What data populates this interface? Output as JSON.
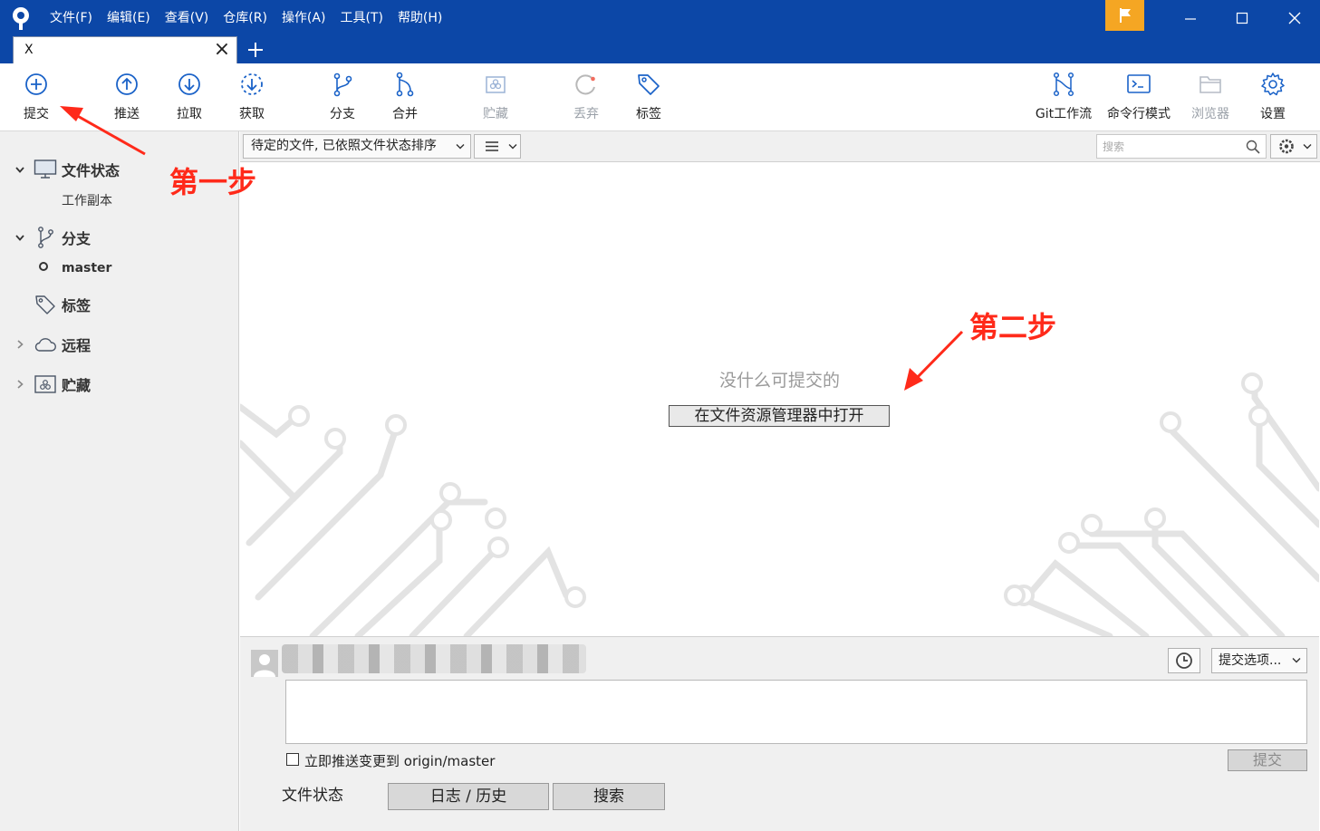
{
  "app": {
    "menu": [
      "文件(F)",
      "编辑(E)",
      "查看(V)",
      "仓库(R)",
      "操作(A)",
      "工具(T)",
      "帮助(H)"
    ],
    "tab_title": "X"
  },
  "toolbar": {
    "commit": "提交",
    "push": "推送",
    "pull": "拉取",
    "fetch": "获取",
    "branch": "分支",
    "merge": "合并",
    "stash": "贮藏",
    "discard": "丢弃",
    "tag": "标签",
    "git_flow": "Git工作流",
    "terminal": "命令行模式",
    "explorer": "浏览器",
    "settings": "设置"
  },
  "sidebar": {
    "file_status": "文件状态",
    "working_copy": "工作副本",
    "branches": "分支",
    "master": "master",
    "tags": "标签",
    "remotes": "远程",
    "stashes": "贮藏"
  },
  "files": {
    "sort_label": "待定的文件, 已依照文件状态排序",
    "search_placeholder": "搜索",
    "empty_message": "没什么可提交的",
    "open_explorer": "在文件资源管理器中打开"
  },
  "commit": {
    "options": "提交选项...",
    "push_immediately": "立即推送变更到 origin/master",
    "commit_button": "提交"
  },
  "bottom_tabs": {
    "file_status": "文件状态",
    "log_history": "日志 / 历史",
    "search": "搜索"
  },
  "annotations": {
    "step1": "第一步",
    "step2": "第二步"
  },
  "colors": {
    "titlebar": "#0c47a7",
    "accent_icon": "#1a62c8",
    "flag": "#f5a623",
    "annotation": "#ff2a1a"
  }
}
